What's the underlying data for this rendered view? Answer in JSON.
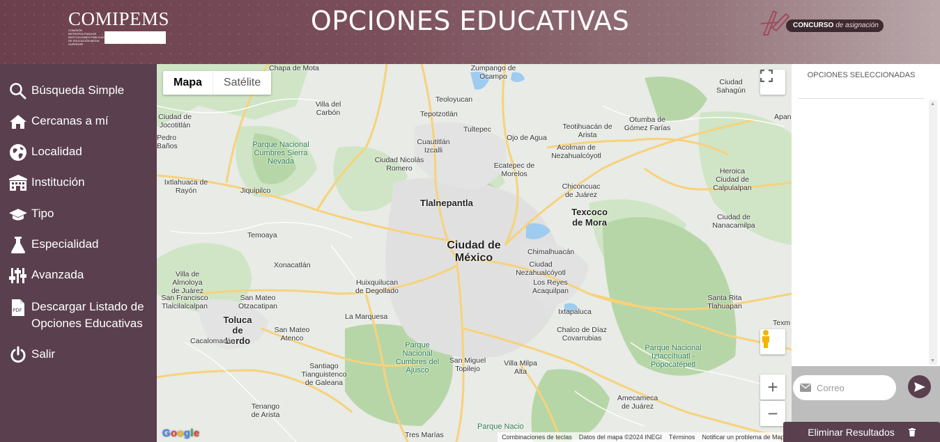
{
  "header": {
    "logo_left": "COMIPEMS",
    "logo_left_sub": "COMISIÓN METROPOLITANA DE INSTITUCIONES PÚBLICAS DE EDUCACIÓN MEDIA SUPERIOR",
    "title": "OPCIONES EDUCATIVAS",
    "logo_right_main": "CONCURSO",
    "logo_right_sub": "de asignación"
  },
  "sidebar": {
    "items": [
      {
        "label": "Búsqueda Simple",
        "icon": "search-icon"
      },
      {
        "label": "Cercanas a mí",
        "icon": "home-icon"
      },
      {
        "label": "Localidad",
        "icon": "globe-icon"
      },
      {
        "label": "Institución",
        "icon": "building-icon"
      },
      {
        "label": "Tipo",
        "icon": "graduation-cap-icon"
      },
      {
        "label": "Especialidad",
        "icon": "flask-icon"
      },
      {
        "label": "Avanzada",
        "icon": "sliders-icon"
      },
      {
        "label": "Descargar Listado de Opciones Educativas",
        "icon": "pdf-file-icon"
      },
      {
        "label": "Salir",
        "icon": "power-icon"
      }
    ]
  },
  "map": {
    "tab_map": "Mapa",
    "tab_satellite": "Satélite",
    "footer": {
      "shortcuts": "Combinaciones de teclas",
      "data": "Datos del mapa ©2024 INEGI",
      "terms": "Términos",
      "report": "Notificar un problema de Maps"
    },
    "labels": {
      "cdmx": "Ciudad de México",
      "tlalnepantla": "Tlalnepantla",
      "texcoco": "Texcoco de Mora",
      "toluca": "Toluca de Lerdo",
      "chapa": "Chapa de Mota",
      "zumpango": "Zumpango de Ocampo",
      "teoloyucan": "Teoloyucan",
      "sahagun": "Ciudad Sahagún",
      "villa_carbon": "Villa del Carbón",
      "tepotzotlan": "Tepotzotlán",
      "tultepec": "Tultepec",
      "teotihuacan": "Teotihuacán de Arista",
      "otumba": "Otumba de Gómez Farías",
      "jocotitlan": "Ciudad de Jocotitlán",
      "cuautitlan": "Cuautitlán Izcalli",
      "ojo_agua": "Ojo de Agua",
      "acolman": "Acolman de Nezahualcóyotl",
      "pedro_banos": "Pedro Baños",
      "nicolas_romero": "Ciudad Nicolás Romero",
      "ecatepec": "Ecatepec de Morelos",
      "calpulalpan": "Heroica Ciudad de Calpulalpan",
      "cumbres_sierra": "Parque Nacional Cumbres Sierra Nevada",
      "ixtlahuaca": "Ixtlahuaca de Rayón",
      "jiquipilco": "Jiquipilco",
      "chiconcuac": "Chiconcuac de Juárez",
      "nanacamilpa": "Ciudad de Nanacamilpa",
      "temoaya": "Temoaya",
      "chimalhuacan": "Chimalhuacán",
      "xonacatlan": "Xonacatlán",
      "neza": "Ciudad Nezahualcóyotl",
      "almoloya": "Villa de Almoloya de Juárez",
      "san_mateo_otz": "San Mateo Otzacatipan",
      "huixquilucan": "Huixquilucan de Degollado",
      "los_reyes": "Los Reyes Acaquilpan",
      "santa_rita": "Santa Rita Tlahuapan",
      "san_francisco": "San Francisco Tlalcilalcalpan",
      "ixtapaluca": "Ixtapaluca",
      "la_marquesa": "La Marquesa",
      "chalco": "Chalco de Díaz Covarrubias",
      "san_mateo_atenco": "San Mateo Atenco",
      "calacomacan": "Cacalomacán",
      "ajusco": "Parque Nacional Cumbres del Ajusco",
      "san_miguel": "San Miguel Topilejo",
      "villa_milpa": "Villa Milpa Alta",
      "izta": "Parque Nacional Iztaccíhuatl - Popocatépetl",
      "santiago": "Santiago Tianguistenco de Galeana",
      "tenango": "Tenango de Arista",
      "amecameca": "Amecameca de Juárez",
      "tres_marias": "Tres Marías",
      "parque_nac": "Parque Nacio",
      "texm": "Texm",
      "apan": "Apan"
    }
  },
  "right_panel": {
    "title": "OPCIONES SELECCIONADAS",
    "email_placeholder": "Correo",
    "clear_label": "Eliminar Resultados"
  }
}
